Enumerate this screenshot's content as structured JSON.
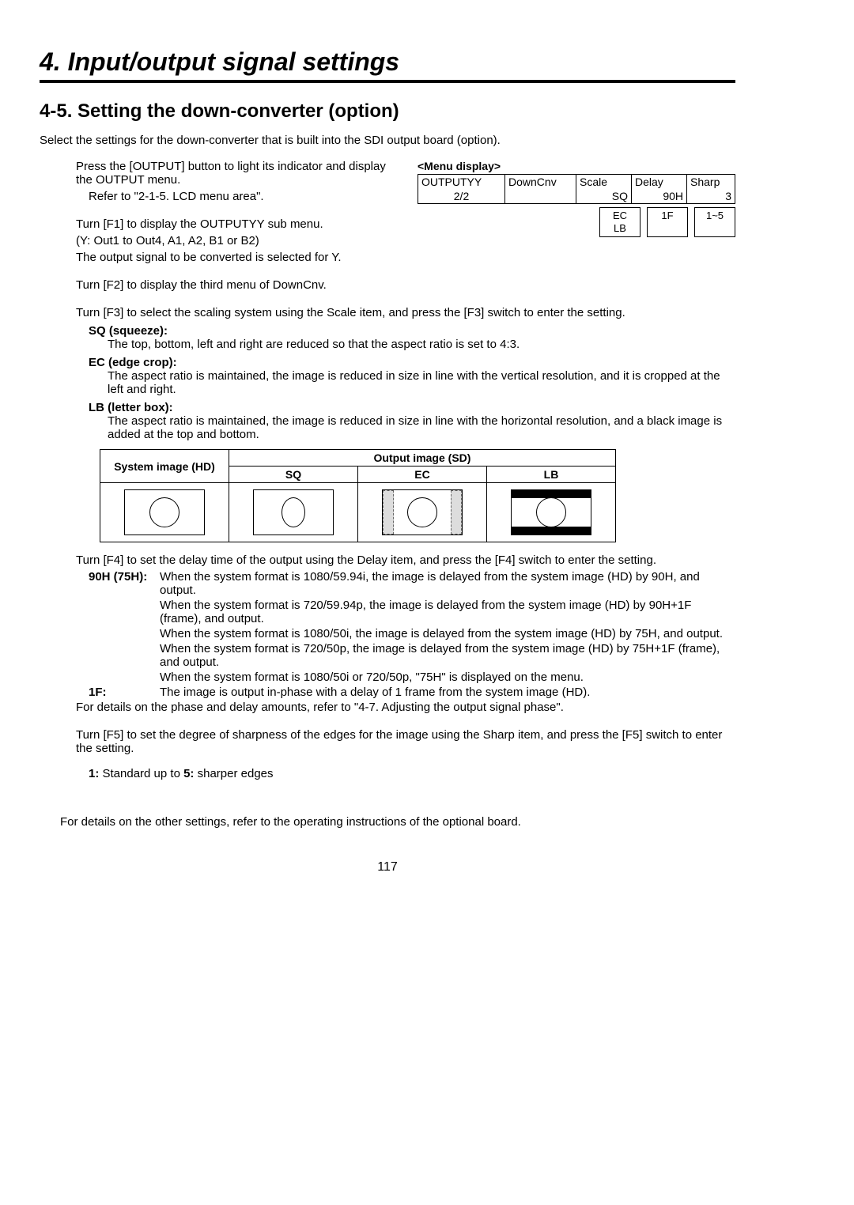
{
  "chapter": "4. Input/output signal settings",
  "section": "4-5. Setting the down-converter (option)",
  "intro": "Select the settings for the down-converter that is built into the SDI output board (option).",
  "step1a": "Press the [OUTPUT] button to light its indicator and display the OUTPUT menu.",
  "step1b": "Refer to \"2-1-5. LCD menu area\".",
  "step2a": "Turn [F1] to display the OUTPUTYY sub menu.",
  "step2b": "(Y: Out1 to Out4, A1, A2, B1 or B2)",
  "step2c": "The output signal to be converted is selected for Y.",
  "step3": "Turn [F2] to display the third menu of DownCnv.",
  "step4": "Turn [F3] to select the scaling system using the Scale item, and press the [F3] switch to enter the setting.",
  "sq_label": "SQ (squeeze):",
  "sq_body": "The top, bottom, left and right are reduced so that the aspect ratio is set to 4:3.",
  "ec_label": "EC (edge crop):",
  "ec_body": "The aspect ratio is maintained, the image is reduced in size in line with the vertical resolution, and it is cropped at the left and right.",
  "lb_label": "LB (letter box):",
  "lb_body": "The aspect ratio is maintained, the image is reduced in size in line with the horizontal resolution, and a black image is added at the top and bottom.",
  "aspect_table": {
    "h_sys": "System image (HD)",
    "h_out": "Output image (SD)",
    "h_sq": "SQ",
    "h_ec": "EC",
    "h_lb": "LB"
  },
  "step5": "Turn [F4] to set the delay time of the output using the Delay item, and press the [F4] switch to enter the setting.",
  "delay": {
    "label1": "90H (75H):",
    "d1": "When the system format is 1080/59.94i, the image is delayed from the system image (HD) by 90H, and output.",
    "d2": "When the system format is 720/59.94p, the image is delayed from the system image (HD) by 90H+1F (frame), and output.",
    "d3": "When the system format is 1080/50i, the image is delayed from the system image (HD) by 75H, and output.",
    "d4": "When the system format is 720/50p, the image is delayed from the system image (HD) by 75H+1F (frame), and output.",
    "d5": "When the system format is 1080/50i or 720/50p, \"75H\" is displayed on the menu.",
    "label2": "1F:",
    "d6": "The image is output in-phase with a delay of 1 frame from the system image (HD)."
  },
  "phase_note": "For details on the phase and delay amounts, refer to \"4-7. Adjusting the output signal phase\".",
  "step6": "Turn [F5] to set the degree of sharpness of the edges for the image using the Sharp item, and press the [F5] switch to enter the setting.",
  "sharp_label1": "1:",
  "sharp_text1": " Standard up to ",
  "sharp_label2": "5:",
  "sharp_text2": " sharper edges",
  "footer_note": "For details on the other settings, refer to the operating instructions of the optional board.",
  "page": "117",
  "menu": {
    "title": "<Menu display>",
    "r1": {
      "c1": "OUTPUTYY",
      "c2": "DownCnv",
      "c3": "Scale",
      "c4": "Delay",
      "c5": "Sharp"
    },
    "r2": {
      "c1": "2/2",
      "c2": "",
      "c3": "SQ",
      "c4": "90H",
      "c5": "3"
    },
    "opts": {
      "a1": "EC",
      "a2": "1F",
      "a3": "1~5",
      "b1": "LB"
    }
  }
}
